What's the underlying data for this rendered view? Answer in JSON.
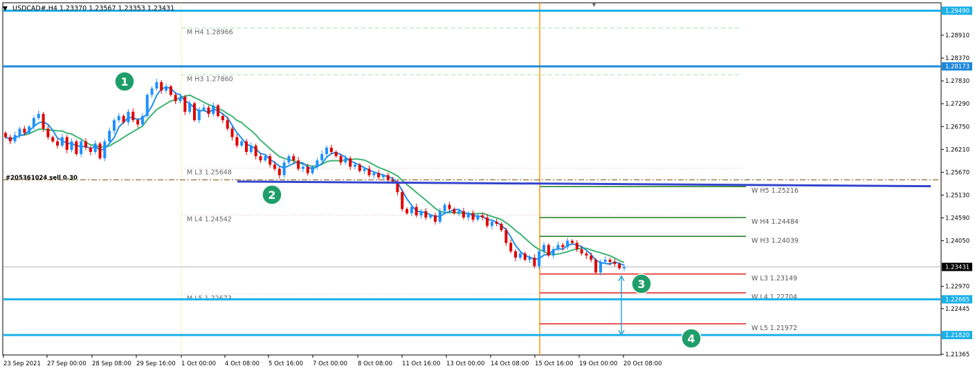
{
  "header": {
    "symbol_line": "USDCAD#,H4  1.23370 1.23567 1.23353 1.23431"
  },
  "order_label": "#205361024 sell 0.30",
  "current_price_label": "1.23431",
  "chart_data": {
    "type": "candlestick",
    "symbol": "USDCAD#",
    "timeframe": "H4",
    "ohlc_header": {
      "open": 1.2337,
      "high": 1.23567,
      "low": 1.23353,
      "close": 1.23431
    },
    "grid": false,
    "y_range": [
      1.214,
      1.299
    ],
    "y_ticks": [
      "1.28910",
      "1.28370",
      "1.27830",
      "1.27290",
      "1.26750",
      "1.26210",
      "1.25670",
      "1.25130",
      "1.24590",
      "1.24050",
      "1.22970",
      "1.22445",
      "1.21365"
    ],
    "x_ticks": [
      "23 Sep 2021",
      "27 Sep 00:00",
      "28 Sep 08:00",
      "29 Sep 16:00",
      "1 Oct 00:00",
      "4 Oct 08:00",
      "5 Oct 16:00",
      "7 Oct 00:00",
      "8 Oct 08:00",
      "11 Oct 16:00",
      "13 Oct 00:00",
      "14 Oct 08:00",
      "15 Oct 16:00",
      "19 Oct 00:00",
      "20 Oct 08:00"
    ],
    "horizontal_levels": [
      {
        "price": 1.2949,
        "label": "1.29490",
        "color": "#1ab0e8"
      },
      {
        "price": 1.28173,
        "label": "1.28173",
        "color": "#1e88d8"
      },
      {
        "price": 1.22665,
        "label": "1.22665",
        "color": "#1ab0e8"
      },
      {
        "price": 1.2182,
        "label": "1.21820",
        "color": "#1ab0e8"
      }
    ],
    "monthly_pivots": [
      {
        "label": "M  H4 1.28966",
        "price": 1.28966
      },
      {
        "label": "M  H3 1.27860",
        "price": 1.2786
      },
      {
        "label": "M  L3 1.25648",
        "price": 1.25648
      },
      {
        "label": "M  L4 1.24542",
        "price": 1.24542
      },
      {
        "label": "M  L5 1.22673",
        "price": 1.22673
      }
    ],
    "weekly_pivots": [
      {
        "label": "W  H5 1.25216",
        "price": 1.25216,
        "color": "#1a7a1a"
      },
      {
        "label": "W  H4 1.24484",
        "price": 1.24484,
        "color": "#1a7a1a"
      },
      {
        "label": "W  H3 1.24039",
        "price": 1.24039,
        "color": "#1a7a1a"
      },
      {
        "label": "W  L3 1.23149",
        "price": 1.23149,
        "color": "#e02020"
      },
      {
        "label": "W  L4 1.22704",
        "price": 1.22704,
        "color": "#e02020"
      },
      {
        "label": "W  L5 1.21972",
        "price": 1.21972,
        "color": "#e02020"
      }
    ],
    "order_line_price": 1.2549,
    "current_price": 1.23431,
    "trendline": {
      "start_price": 1.2545,
      "end_price": 1.2534
    },
    "markers": [
      "1",
      "2",
      "3",
      "4"
    ],
    "close_prices": [
      1.265,
      1.264,
      1.2655,
      1.267,
      1.266,
      1.2675,
      1.2695,
      1.2705,
      1.267,
      1.265,
      1.264,
      1.263,
      1.265,
      1.262,
      1.264,
      1.261,
      1.264,
      1.2625,
      1.2615,
      1.2635,
      1.26,
      1.264,
      1.2665,
      1.269,
      1.27,
      1.2685,
      1.271,
      1.269,
      1.268,
      1.27,
      1.275,
      1.2765,
      1.278,
      1.276,
      1.277,
      1.275,
      1.2735,
      1.2745,
      1.271,
      1.273,
      1.269,
      1.2715,
      1.272,
      1.2705,
      1.2725,
      1.27,
      1.269,
      1.267,
      1.265,
      1.263,
      1.264,
      1.2615,
      1.263,
      1.2605,
      1.2595,
      1.2605,
      1.2585,
      1.2575,
      1.256,
      1.259,
      1.2605,
      1.2595,
      1.2575,
      1.258,
      1.2565,
      1.258,
      1.2595,
      1.261,
      1.2625,
      1.2615,
      1.2605,
      1.259,
      1.26,
      1.258,
      1.2585,
      1.257,
      1.2575,
      1.256,
      1.2565,
      1.2555,
      1.256,
      1.2548,
      1.2545,
      1.252,
      1.248,
      1.247,
      1.2485,
      1.2465,
      1.2475,
      1.246,
      1.2465,
      1.245,
      1.2475,
      1.249,
      1.248,
      1.247,
      1.2475,
      1.246,
      1.247,
      1.2455,
      1.2465,
      1.246,
      1.244,
      1.245,
      1.2445,
      1.243,
      1.24,
      1.238,
      1.2365,
      1.2375,
      1.236,
      1.2365,
      1.2345,
      1.238,
      1.2395,
      1.237,
      1.2385,
      1.2395,
      1.239,
      1.2405,
      1.24,
      1.2385,
      1.2375,
      1.237,
      1.236,
      1.233,
      1.2355,
      1.236,
      1.2355,
      1.235,
      1.234,
      1.2343
    ],
    "series": [
      {
        "name": "",
        "color": "#1e90e8",
        "type": "fast_ma"
      },
      {
        "name": "",
        "color": "#3cb371",
        "type": "slow_ma"
      }
    ]
  }
}
